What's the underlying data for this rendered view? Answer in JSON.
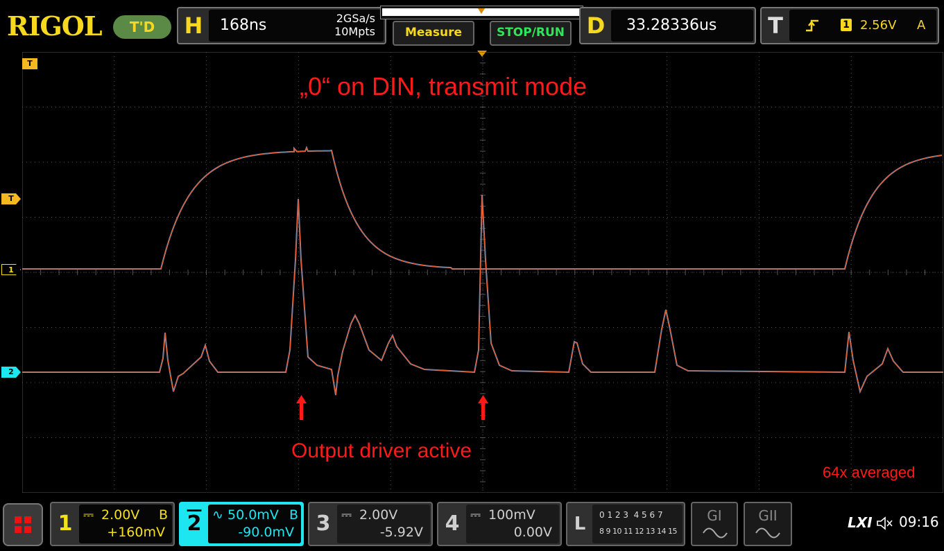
{
  "brand": "RIGOL",
  "trigger_status": "T'D",
  "horizontal": {
    "letter": "H",
    "timebase": "168ns",
    "sample_rate": "2GSa/s",
    "memory_depth": "10Mpts"
  },
  "buttons": {
    "measure": "Measure",
    "stop_run": "STOP/RUN"
  },
  "delay": {
    "letter": "D",
    "value": "33.28336us"
  },
  "trigger": {
    "letter": "T",
    "source_num": "1",
    "level": "2.56V",
    "mode": "A"
  },
  "annotations": {
    "title": "„0“ on DIN, transmit mode",
    "label": "Output driver active",
    "averaging": "64x averaged"
  },
  "markers": {
    "trigger_level": "T",
    "ch1": "1",
    "ch2": "2"
  },
  "channels": [
    {
      "num": "1",
      "coupling": "⎓",
      "scale": "2.00V",
      "bw": "B",
      "offset": "+160mV",
      "color": "#f5e11a"
    },
    {
      "num": "2",
      "coupling": "∿",
      "scale": "50.0mV",
      "bw": "B",
      "offset": "-90.0mV",
      "color": "#1ee6f0"
    },
    {
      "num": "3",
      "coupling": "⎓",
      "scale": "2.00V",
      "bw": "",
      "offset": "-5.92V",
      "color": "#cfcfcf"
    },
    {
      "num": "4",
      "coupling": "⎓",
      "scale": "100mV",
      "bw": "",
      "offset": "0.00V",
      "color": "#cfcfcf"
    }
  ],
  "logic": {
    "letter": "L",
    "row1": "0 1 2 3  4 5 6 7",
    "row2": "8 9 10 11 12 13 14 15"
  },
  "generators": [
    "GI",
    "GII"
  ],
  "status": {
    "lxi": "LXI",
    "time": "09:16"
  },
  "colors": {
    "ch1": "#f5e11a",
    "ch2": "#1ee6f0",
    "trace_overlay": "#e8582a",
    "annotation": "#ff1a1a",
    "accent": "#f6d81e"
  }
}
